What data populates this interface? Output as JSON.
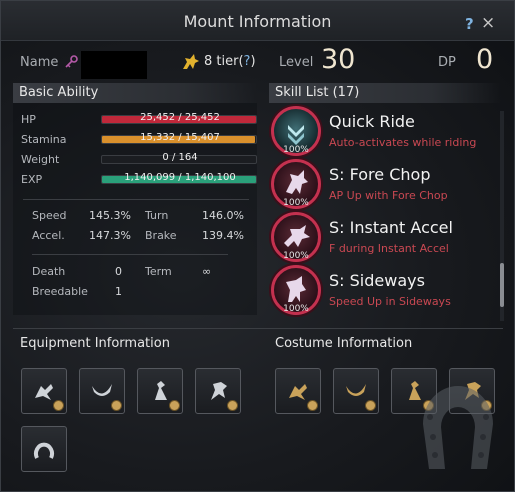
{
  "window": {
    "title": "Mount Information",
    "help_label": "?",
    "close_label": "×"
  },
  "info": {
    "name_label": "Name",
    "tier_value": "8 tier(",
    "tier_help": "?",
    "tier_close": ")",
    "level_label": "Level",
    "level_value": "30",
    "dp_label": "DP",
    "dp_value": "0"
  },
  "basic": {
    "header": "Basic Ability",
    "hp": {
      "label": "HP",
      "text": "25,452 / 25,452",
      "fraction": 1.0,
      "color": "#c0283a"
    },
    "stamina": {
      "label": "Stamina",
      "text": "15,332 / 15,407",
      "fraction": 0.995,
      "color": "#d9902c"
    },
    "weight": {
      "label": "Weight",
      "text": "0 / 164",
      "fraction": 0.0,
      "color": "#7a7a7a"
    },
    "exp": {
      "label": "EXP",
      "text": "1,140,099 / 1,140,100",
      "fraction": 1.0,
      "color": "#2aa07a"
    },
    "speed_label": "Speed",
    "speed_value": "145.3%",
    "turn_label": "Turn",
    "turn_value": "146.0%",
    "accel_label": "Accel.",
    "accel_value": "147.3%",
    "brake_label": "Brake",
    "brake_value": "139.4%",
    "death_label": "Death",
    "death_value": "0",
    "term_label": "Term",
    "term_value": "∞",
    "breedable_label": "Breedable",
    "breedable_value": "1"
  },
  "skills": {
    "header": "Skill List (17)",
    "items": [
      {
        "name": "Quick Ride",
        "desc": "Auto-activates while riding",
        "pct": "100%"
      },
      {
        "name": "S: Fore Chop",
        "desc": "AP Up with Fore Chop",
        "pct": "100%"
      },
      {
        "name": "S: Instant Accel",
        "desc": "F during Instant Accel",
        "pct": "100%"
      },
      {
        "name": "S: Sideways",
        "desc": "Speed Up in Sideways",
        "pct": "100%"
      }
    ]
  },
  "equipment": {
    "header": "Equipment Information"
  },
  "costume": {
    "header": "Costume Information"
  }
}
